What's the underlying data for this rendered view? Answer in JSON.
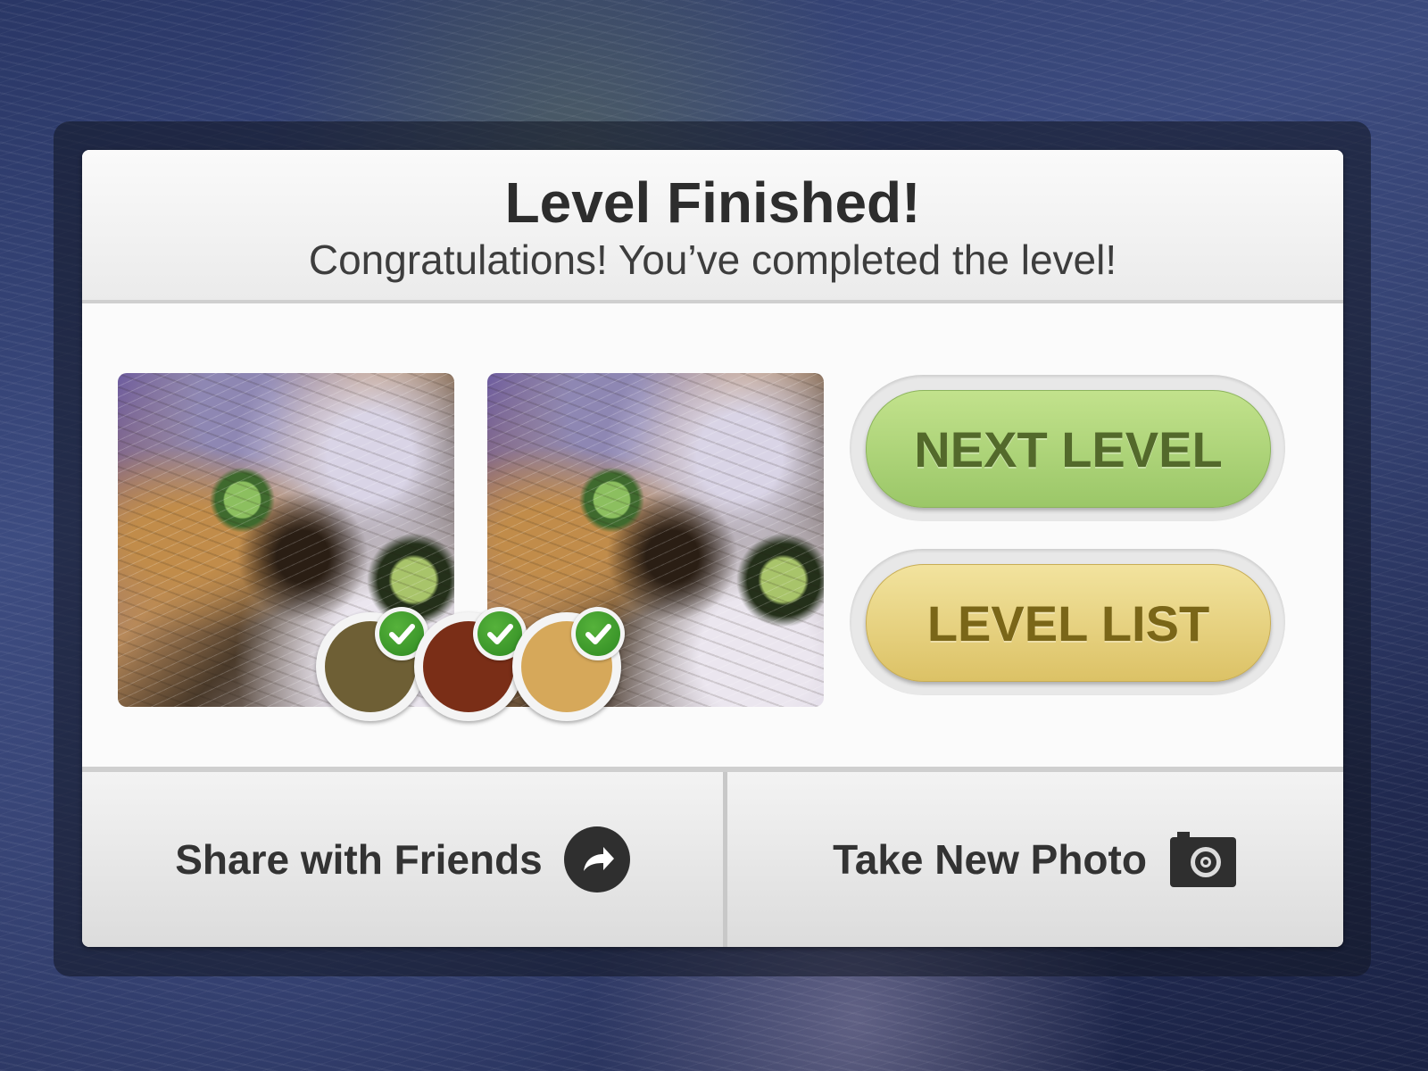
{
  "dialog": {
    "title": "Level Finished!",
    "subtitle": "Congratulations! You’ve completed the level!"
  },
  "photos": [
    {
      "name": "original-photo",
      "subject": "cat-face"
    },
    {
      "name": "edited-photo",
      "subject": "cat-face"
    }
  ],
  "color_swatches": [
    {
      "color": "#6e5f35",
      "matched": true
    },
    {
      "color": "#7a2e17",
      "matched": true
    },
    {
      "color": "#d6a85a",
      "matched": true
    }
  ],
  "buttons": {
    "next_level": "NEXT LEVEL",
    "level_list": "LEVEL LIST"
  },
  "footer": {
    "share": "Share with Friends",
    "take_photo": "Take New Photo"
  },
  "colors": {
    "next_level_bg": "#b4d97d",
    "level_list_bg": "#e8d280",
    "check_green": "#3a9a2a"
  },
  "icons": {
    "share": "share-arrow-icon",
    "camera": "camera-icon",
    "check": "checkmark-icon"
  }
}
